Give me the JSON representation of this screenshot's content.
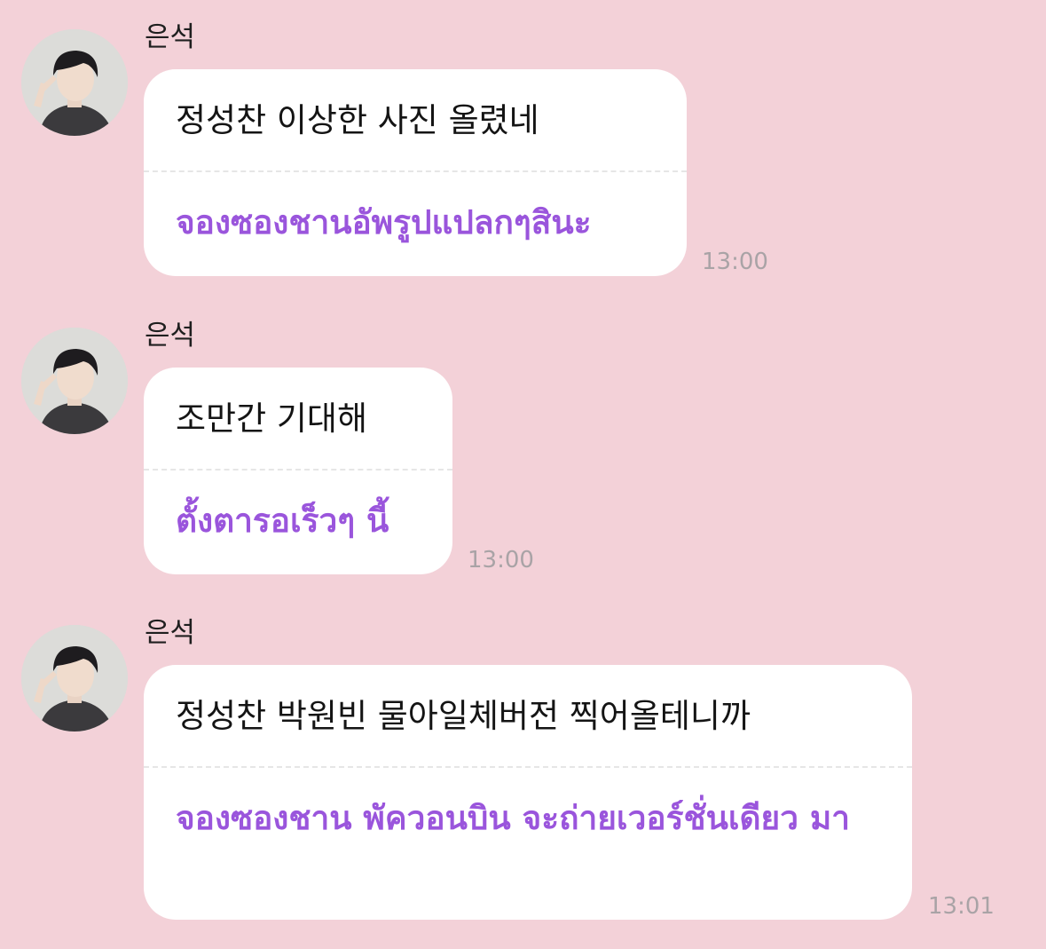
{
  "messages": [
    {
      "sender": "은석",
      "original": "정성찬 이상한 사진 올렸네",
      "translation": "จองซองชานอัพรูปแปลกๆสินะ",
      "time": "13:00"
    },
    {
      "sender": "은석",
      "original": "조만간 기대해",
      "translation": "ตั้งตารอเร็วๆ นี้",
      "time": "13:00"
    },
    {
      "sender": "은석",
      "original": "정성찬 박원빈 물아일체버전 찍어올테니까",
      "translation": "จองซองชาน พัควอนบิน จะถ่ายเวอร์ชั่นเดียว มา",
      "time": "13:01"
    }
  ],
  "colors": {
    "background": "#f3d1d8",
    "bubble": "#ffffff",
    "translation_text": "#9a55dc",
    "timestamp": "#a9a3a6"
  },
  "icons": {
    "avatar": "user-profile-photo"
  }
}
